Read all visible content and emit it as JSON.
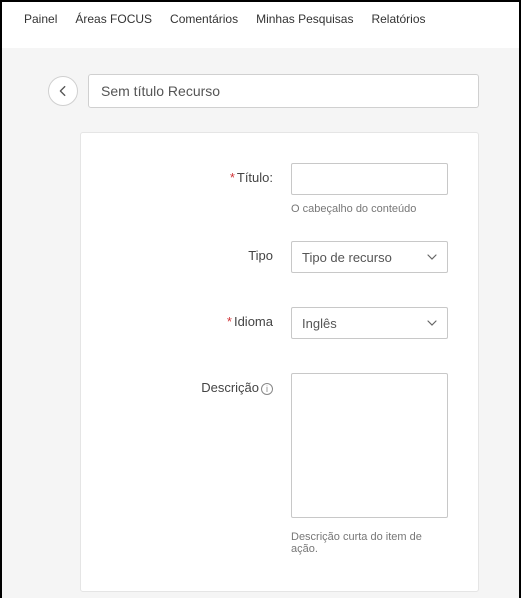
{
  "nav": {
    "item0": "Painel",
    "item1": "Áreas FOCUS",
    "item2": "Comentários",
    "item3": "Minhas Pesquisas",
    "item4": "Relatórios"
  },
  "header": {
    "title_value": "Sem título Recurso"
  },
  "form": {
    "titulo": {
      "label": "Título:",
      "value": "",
      "hint": "O cabeçalho do conteúdo"
    },
    "tipo": {
      "label": "Tipo",
      "selected": "Tipo de recurso"
    },
    "idioma": {
      "label": "Idioma",
      "selected": "Inglês"
    },
    "descricao": {
      "label": "Descrição",
      "value": "",
      "hint": "Descrição curta do item de ação."
    }
  }
}
